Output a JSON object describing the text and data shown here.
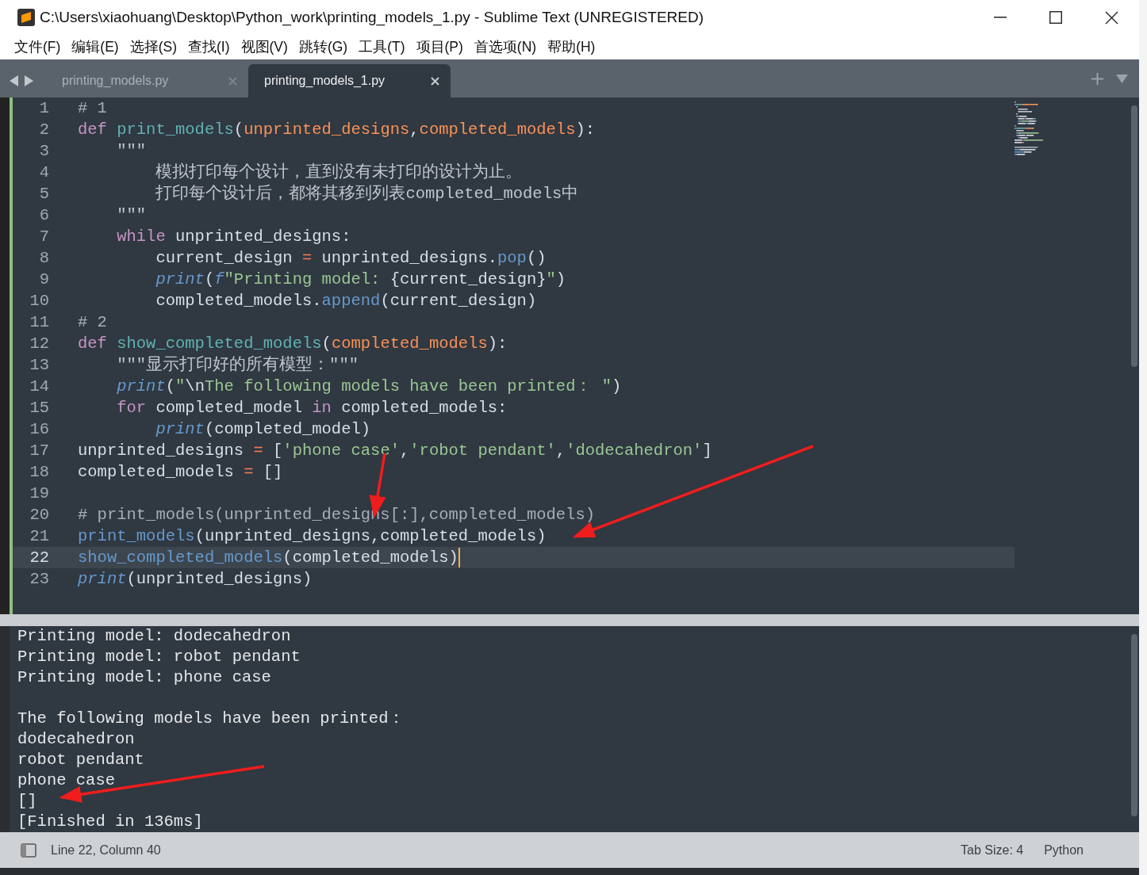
{
  "window": {
    "title": "C:\\Users\\xiaohuang\\Desktop\\Python_work\\printing_models_1.py - Sublime Text (UNREGISTERED)"
  },
  "menu": [
    "文件(F)",
    "编辑(E)",
    "选择(S)",
    "查找(I)",
    "视图(V)",
    "跳转(G)",
    "工具(T)",
    "项目(P)",
    "首选项(N)",
    "帮助(H)"
  ],
  "tabs": [
    {
      "label": "printing_models.py",
      "selected": false
    },
    {
      "label": "printing_models_1.py",
      "selected": true
    }
  ],
  "editor": {
    "lines": [
      {
        "number": "1",
        "current": false,
        "tokens": [
          {
            "kind": "comment",
            "text": "# 1"
          }
        ]
      },
      {
        "number": "2",
        "current": false,
        "tokens": [
          {
            "kind": "keyword",
            "text": "def"
          },
          {
            "kind": "function",
            "text": " print_models"
          },
          {
            "kind": "plain",
            "text": "("
          },
          {
            "kind": "param",
            "text": "unprinted_designs"
          },
          {
            "kind": "plain",
            "text": ","
          },
          {
            "kind": "param",
            "text": "completed_models"
          },
          {
            "kind": "plain",
            "text": "):"
          }
        ]
      },
      {
        "number": "3",
        "current": false,
        "tokens": [
          {
            "kind": "docstring",
            "text": "    \"\"\""
          }
        ]
      },
      {
        "number": "4",
        "current": false,
        "tokens": [
          {
            "kind": "docstring",
            "text": "        模拟打印每个设计，直到没有未打印的设计为止。"
          }
        ]
      },
      {
        "number": "5",
        "current": false,
        "tokens": [
          {
            "kind": "docstring",
            "text": "        打印每个设计后，都将其移到列表completed_models中"
          }
        ]
      },
      {
        "number": "6",
        "current": false,
        "tokens": [
          {
            "kind": "docstring",
            "text": "    \"\"\""
          }
        ]
      },
      {
        "number": "7",
        "current": false,
        "tokens": [
          {
            "kind": "keyword",
            "text": "    while"
          },
          {
            "kind": "plain",
            "text": " unprinted_designs:"
          }
        ]
      },
      {
        "number": "8",
        "current": false,
        "tokens": [
          {
            "kind": "plain",
            "text": "        current_design "
          },
          {
            "kind": "operator",
            "text": "="
          },
          {
            "kind": "plain",
            "text": " unprinted_designs."
          },
          {
            "kind": "method",
            "text": "pop"
          },
          {
            "kind": "plain",
            "text": "()"
          }
        ]
      },
      {
        "number": "9",
        "current": false,
        "tokens": [
          {
            "kind": "builtin",
            "text": "        print"
          },
          {
            "kind": "plain",
            "text": "("
          },
          {
            "kind": "builtin",
            "text": "f"
          },
          {
            "kind": "string",
            "text": "\"Printing model: "
          },
          {
            "kind": "plain",
            "text": "{current_design}"
          },
          {
            "kind": "string",
            "text": "\""
          },
          {
            "kind": "plain",
            "text": ")"
          }
        ]
      },
      {
        "number": "10",
        "current": false,
        "tokens": [
          {
            "kind": "plain",
            "text": "        completed_models."
          },
          {
            "kind": "method",
            "text": "append"
          },
          {
            "kind": "plain",
            "text": "(current_design)"
          }
        ]
      },
      {
        "number": "11",
        "current": false,
        "tokens": [
          {
            "kind": "comment",
            "text": "# 2"
          }
        ]
      },
      {
        "number": "12",
        "current": false,
        "tokens": [
          {
            "kind": "keyword",
            "text": "def"
          },
          {
            "kind": "function",
            "text": " show_completed_models"
          },
          {
            "kind": "plain",
            "text": "("
          },
          {
            "kind": "param",
            "text": "completed_models"
          },
          {
            "kind": "plain",
            "text": "):"
          }
        ]
      },
      {
        "number": "13",
        "current": false,
        "tokens": [
          {
            "kind": "docstring",
            "text": "    \"\"\"显示打印好的所有模型：\"\"\""
          }
        ]
      },
      {
        "number": "14",
        "current": false,
        "tokens": [
          {
            "kind": "builtin",
            "text": "    print"
          },
          {
            "kind": "plain",
            "text": "("
          },
          {
            "kind": "string",
            "text": "\""
          },
          {
            "kind": "plain",
            "text": "\\n"
          },
          {
            "kind": "string",
            "text": "The following models have been printed： \""
          },
          {
            "kind": "plain",
            "text": ")"
          }
        ]
      },
      {
        "number": "15",
        "current": false,
        "tokens": [
          {
            "kind": "keyword",
            "text": "    for"
          },
          {
            "kind": "plain",
            "text": " completed_model "
          },
          {
            "kind": "keyword",
            "text": "in"
          },
          {
            "kind": "plain",
            "text": " completed_models:"
          }
        ]
      },
      {
        "number": "16",
        "current": false,
        "tokens": [
          {
            "kind": "builtin",
            "text": "        print"
          },
          {
            "kind": "plain",
            "text": "(completed_model)"
          }
        ]
      },
      {
        "number": "17",
        "current": false,
        "tokens": [
          {
            "kind": "plain",
            "text": "unprinted_designs "
          },
          {
            "kind": "operator",
            "text": "="
          },
          {
            "kind": "plain",
            "text": " ["
          },
          {
            "kind": "string",
            "text": "'phone case'"
          },
          {
            "kind": "plain",
            "text": ","
          },
          {
            "kind": "string",
            "text": "'robot pendant'"
          },
          {
            "kind": "plain",
            "text": ","
          },
          {
            "kind": "string",
            "text": "'dodecahedron'"
          },
          {
            "kind": "plain",
            "text": "]"
          }
        ]
      },
      {
        "number": "18",
        "current": false,
        "tokens": [
          {
            "kind": "plain",
            "text": "completed_models "
          },
          {
            "kind": "operator",
            "text": "="
          },
          {
            "kind": "plain",
            "text": " []"
          }
        ]
      },
      {
        "number": "19",
        "current": false
      },
      {
        "number": "20",
        "current": false,
        "tokens": [
          {
            "kind": "comment",
            "text": "# print_models(unprinted_designs[:],completed_models)"
          }
        ]
      },
      {
        "number": "21",
        "current": false,
        "tokens": [
          {
            "kind": "method",
            "text": "print_models"
          },
          {
            "kind": "plain",
            "text": "(unprinted_designs,completed_models)"
          }
        ]
      },
      {
        "number": "22",
        "current": true,
        "tokens": [
          {
            "kind": "method",
            "text": "show_completed_models"
          },
          {
            "kind": "plain",
            "text": "(completed_models)"
          }
        ]
      },
      {
        "number": "23",
        "current": false,
        "tokens": [
          {
            "kind": "builtin",
            "text": "print"
          },
          {
            "kind": "plain",
            "text": "(unprinted_designs)"
          }
        ]
      }
    ]
  },
  "output": {
    "blocks": [
      [
        "Printing model: dodecahedron",
        "Printing model: robot pendant",
        "Printing model: phone case"
      ],
      [
        "The following models have been printed：",
        "dodecahedron",
        "robot pendant",
        "phone case",
        "[]",
        "[Finished in 136ms]"
      ]
    ]
  },
  "status_bar": {
    "position": "Line 22, Column 40",
    "tab_size": "Tab Size: 4",
    "syntax": "Python"
  }
}
